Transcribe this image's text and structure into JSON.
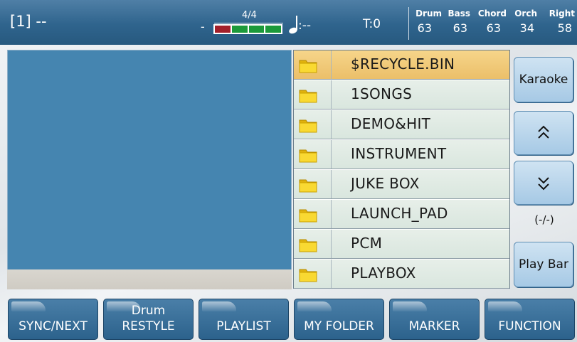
{
  "header": {
    "song_position": "[1] --",
    "meter_dash": "-",
    "time_signature": "4/4",
    "meter_beats": [
      "#a3202a",
      "#1c9a3a",
      "#1c9a3a",
      "#1c9a3a"
    ],
    "note_dots": ":--",
    "tempo": "T:0",
    "mixer": [
      {
        "name": "Drum",
        "value": "63"
      },
      {
        "name": "Bass",
        "value": "63"
      },
      {
        "name": "Chord",
        "value": "63"
      },
      {
        "name": "Orch",
        "value": "34"
      },
      {
        "name": "Right",
        "value": "58"
      }
    ]
  },
  "file_list": {
    "selected_index": 0,
    "items": [
      {
        "label": "$RECYCLE.BIN",
        "icon": "folder-icon"
      },
      {
        "label": "1SONGS",
        "icon": "folder-icon"
      },
      {
        "label": "DEMO&HIT",
        "icon": "folder-icon"
      },
      {
        "label": "INSTRUMENT",
        "icon": "folder-icon"
      },
      {
        "label": "JUKE BOX",
        "icon": "folder-icon"
      },
      {
        "label": "LAUNCH_PAD",
        "icon": "folder-icon"
      },
      {
        "label": "PCM",
        "icon": "folder-icon"
      },
      {
        "label": "PLAYBOX",
        "icon": "folder-icon"
      }
    ]
  },
  "side_panel": {
    "karaoke_label": "Karaoke",
    "page_up_icon": "double-chevron-up-icon",
    "page_down_icon": "double-chevron-down-icon",
    "page_indicator": "(-/-)",
    "play_bar_label": "Play Bar"
  },
  "softkeys": [
    {
      "top": "",
      "label": "SYNC/NEXT"
    },
    {
      "top": "Drum",
      "label": "RESTYLE"
    },
    {
      "top": "",
      "label": "PLAYLIST"
    },
    {
      "top": "",
      "label": "MY FOLDER"
    },
    {
      "top": "",
      "label": "MARKER"
    },
    {
      "top": "",
      "label": "FUNCTION"
    }
  ],
  "colors": {
    "header_blue": "#2f648d",
    "selected_row": "#f0c870",
    "row_bg": "#e0ebe4",
    "folder_yellow": "#f7d21a"
  }
}
